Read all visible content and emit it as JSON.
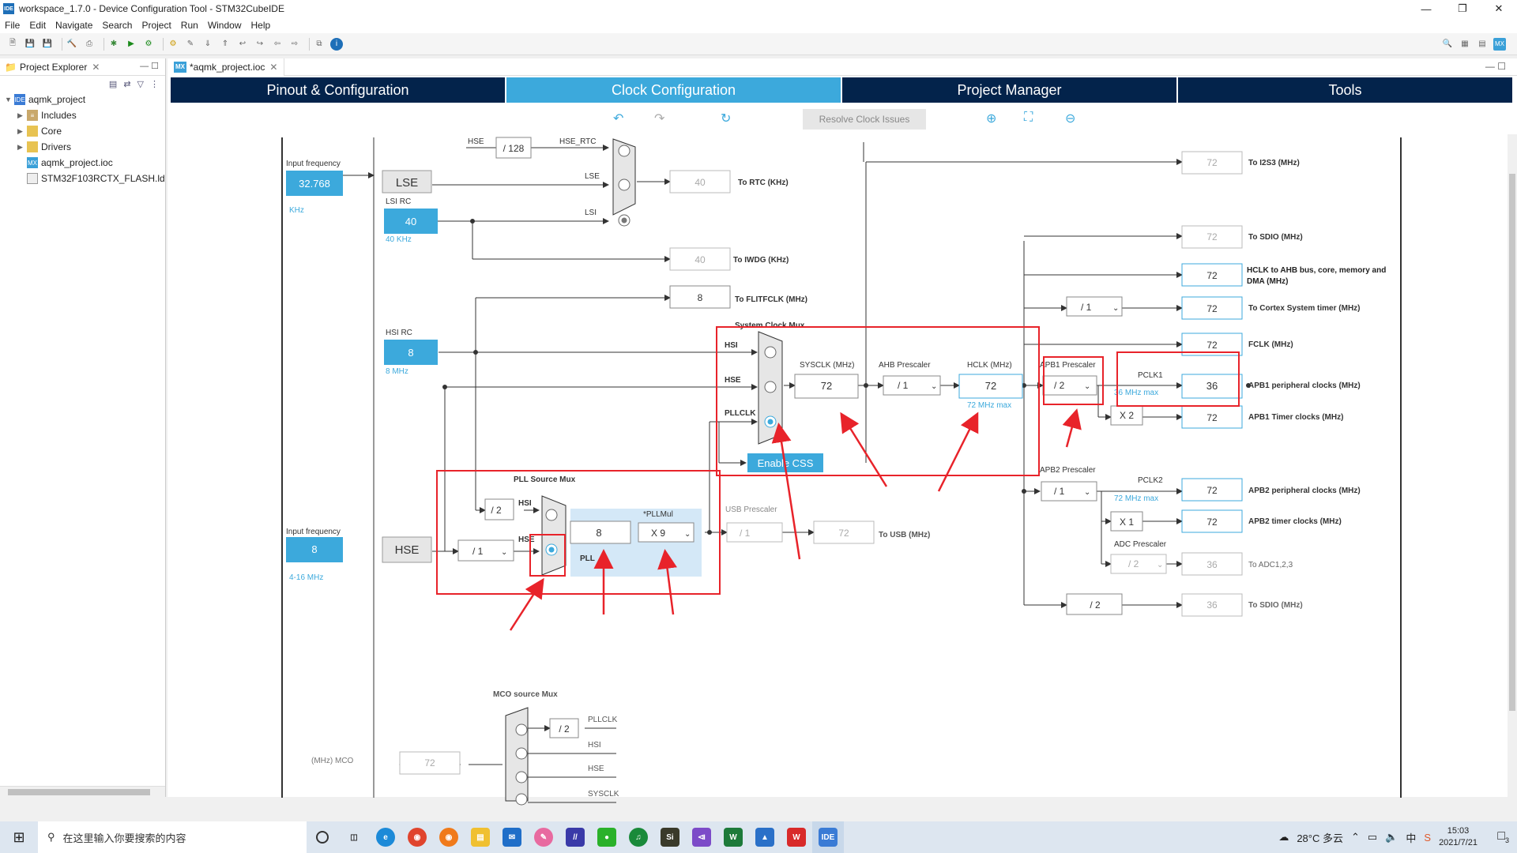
{
  "window": {
    "title": "workspace_1.7.0 - Device Configuration Tool - STM32CubeIDE",
    "app_icon": "IDE"
  },
  "menu": [
    "File",
    "Edit",
    "Navigate",
    "Search",
    "Project",
    "Run",
    "Window",
    "Help"
  ],
  "explorer": {
    "title": "Project Explorer",
    "project": "aqmk_project",
    "items": [
      "Includes",
      "Core",
      "Drivers",
      "aqmk_project.ioc",
      "STM32F103RCTX_FLASH.ld"
    ]
  },
  "editor_tab": {
    "label": "*aqmk_project.ioc",
    "icon": "MX"
  },
  "mx_tabs": [
    "Pinout & Configuration",
    "Clock Configuration",
    "Project Manager",
    "Tools"
  ],
  "clock_toolbar": {
    "resolve": "Resolve Clock Issues"
  },
  "clock": {
    "lse_input_label": "Input frequency",
    "lse_input": "32.768",
    "lse_unit": "KHz",
    "lse": "LSE",
    "lsi_rc_label": "LSI RC",
    "lsi": "40",
    "lsi_unit": "40 KHz",
    "hse_rtc": "HSE",
    "div128": "/ 128",
    "hse_rtc_label": "HSE_RTC",
    "lse_small": "LSE",
    "lsi_small": "LSI",
    "rtc_value": "40",
    "rtc_label": "To RTC (KHz)",
    "iwdg_value": "40",
    "iwdg_label": "To IWDG (KHz)",
    "flitf_value": "8",
    "flitf_label": "To FLITFCLK (MHz)",
    "hsi_rc_label": "HSI RC",
    "hsi": "8",
    "hsi_unit": "8 MHz",
    "sysclk_mux_label": "System Clock Mux",
    "mux_hsi": "HSI",
    "mux_hse": "HSE",
    "mux_pllclk": "PLLCLK",
    "sysclk_label": "SYSCLK (MHz)",
    "sysclk": "72",
    "ahb_label": "AHB Prescaler",
    "ahb": "/ 1",
    "hclk_label": "HCLK (MHz)",
    "hclk": "72",
    "hclk_max": "72 MHz max",
    "enable_css": "Enable CSS",
    "pll_src_label": "PLL Source Mux",
    "pll_div2": "/ 2",
    "pll_hsi": "HSI",
    "pll_hse": "HSE",
    "pll_value": "8",
    "pll_label": "PLL",
    "pllmul_label": "*PLLMul",
    "pllmul": "X 9",
    "usb_label": "USB Prescaler",
    "usb_presc": "/ 1",
    "usb_value": "72",
    "usb_to": "To USB (MHz)",
    "hse_input_label": "Input frequency",
    "hse_input": "8",
    "hse_unit": "4-16 MHz",
    "hse": "HSE",
    "hse_div": "/ 1",
    "i2s3_value": "72",
    "i2s3_label": "To I2S3 (MHz)",
    "sdio_value": "72",
    "sdio_label": "To SDIO (MHz)",
    "ahb_out_value": "72",
    "ahb_out_label": "HCLK to AHB bus, core, memory and DMA (MHz)",
    "cortex_div": "/ 1",
    "cortex_value": "72",
    "cortex_label": "To Cortex System timer (MHz)",
    "fclk_value": "72",
    "fclk_label": "FCLK (MHz)",
    "apb1_label": "APB1 Prescaler",
    "apb1": "/ 2",
    "pclk1_label": "PCLK1",
    "pclk1_max": "36 MHz max",
    "apb1_periph_value": "36",
    "apb1_periph_label": "APB1 peripheral clocks (MHz)",
    "apb1_x2": "X 2",
    "apb1_timer_value": "72",
    "apb1_timer_label": "APB1 Timer clocks (MHz)",
    "apb2_label": "APB2 Prescaler",
    "apb2": "/ 1",
    "pclk2_label": "PCLK2",
    "pclk2_max": "72 MHz max",
    "apb2_periph_value": "72",
    "apb2_periph_label": "APB2 peripheral clocks (MHz)",
    "apb2_x1": "X 1",
    "apb2_timer_value": "72",
    "apb2_timer_label": "APB2 timer clocks (MHz)",
    "adc_label": "ADC Prescaler",
    "adc": "/ 2",
    "adc_value": "36",
    "adc_to": "To ADC1,2,3",
    "sdio2_div": "/ 2",
    "sdio2_value": "36",
    "sdio2_label": "To SDIO (MHz)",
    "mco_label": "MCO source Mux",
    "mco_div2": "/ 2",
    "mco_pllclk": "PLLCLK",
    "mco_hsi": "HSI",
    "mco_hse": "HSE",
    "mco_sysclk": "SYSCLK",
    "mco_value": "72",
    "mco_out": "(MHz) MCO"
  },
  "taskbar": {
    "search_placeholder": "在这里输入你要搜索的内容",
    "weather": "28°C 多云",
    "time": "15:03",
    "date": "2021/7/21",
    "notif_count": "3"
  },
  "colors": {
    "accent": "#3ca9dc",
    "navy": "#03234b",
    "annot": "#e8232a"
  }
}
